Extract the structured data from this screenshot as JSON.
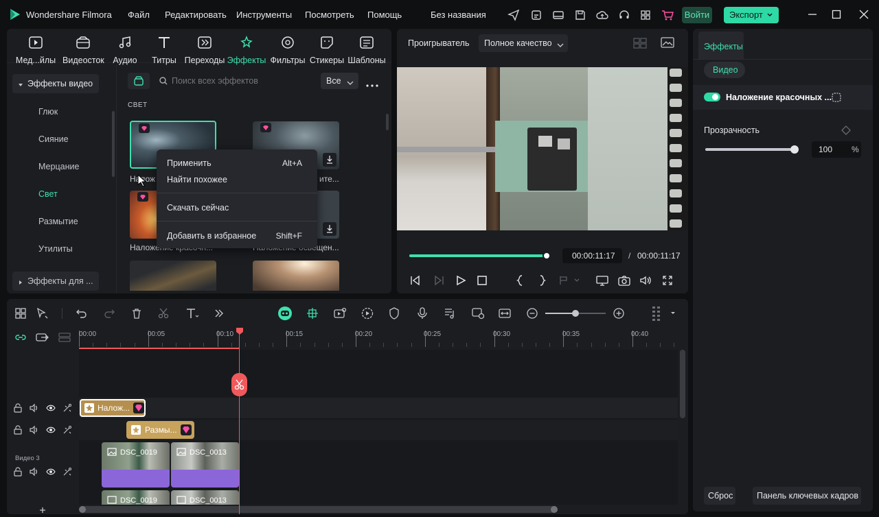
{
  "app": {
    "name": "Wondershare Filmora",
    "project": "Без названия",
    "menu": [
      "Файл",
      "Редактировать",
      "Инструменты",
      "Посмотреть",
      "Помощь"
    ],
    "login": "Войти",
    "export": "Экспорт"
  },
  "media_tabs": [
    "Мед...йлы",
    "Видеосток",
    "Аудио",
    "Титры",
    "Переходы",
    "Эффекты",
    "Фильтры",
    "Стикеры",
    "Шаблоны"
  ],
  "sidebar": {
    "group1": "Эффекты видео",
    "items": [
      "Глюк",
      "Сияние",
      "Мерцание",
      "Свет",
      "Размытие",
      "Утилиты"
    ],
    "group2": "Эффекты для ..."
  },
  "search": {
    "placeholder": "Поиск всех эффектов",
    "filter": "Все"
  },
  "section_title": "СВЕТ",
  "thumbs": {
    "t1_label": "Налож",
    "t2_label": "Наложение освещен...ите...",
    "t2_label_visible": "ите...",
    "t3_label": "Наложение красочн...",
    "t4_label": "Наложение освещен..."
  },
  "context_menu": {
    "apply": "Применить",
    "apply_shortcut": "Alt+A",
    "find_similar": "Найти похожее",
    "download": "Скачать сейчас",
    "favorite": "Добавить в избранное",
    "favorite_shortcut": "Shift+F"
  },
  "player": {
    "title": "Проигрыватель",
    "quality": "Полное качество",
    "current_time": "00:00:11:17",
    "separator": "/",
    "total_time": "00:00:11:17",
    "progress": 1.0
  },
  "props": {
    "tab": "Эффекты",
    "subtab": "Видео",
    "effect_name": "Наложение красочных ...",
    "opacity_label": "Прозрачность",
    "opacity_value": "100",
    "opacity_unit": "%",
    "reset": "Сброс",
    "keyframes": "Панель ключевых кадров"
  },
  "timeline": {
    "ruler": [
      "00:00",
      "00:05",
      "00:10",
      "00:15",
      "00:20",
      "00:25",
      "00:30",
      "00:35",
      "00:40"
    ],
    "track_label": "Видео 3",
    "clip_effect1": "Налож...",
    "clip_effect2": "Размы...",
    "clip_video1": "DSC_0019",
    "clip_video2": "DSC_0013",
    "clip_video3": "DSC_0019",
    "clip_video4": "DSC_0013"
  },
  "colors": {
    "accent": "#2ed9a5",
    "playhead": "#f0595b",
    "effect_clip": "#c8a35c",
    "video_clip": "#8b66d9"
  }
}
